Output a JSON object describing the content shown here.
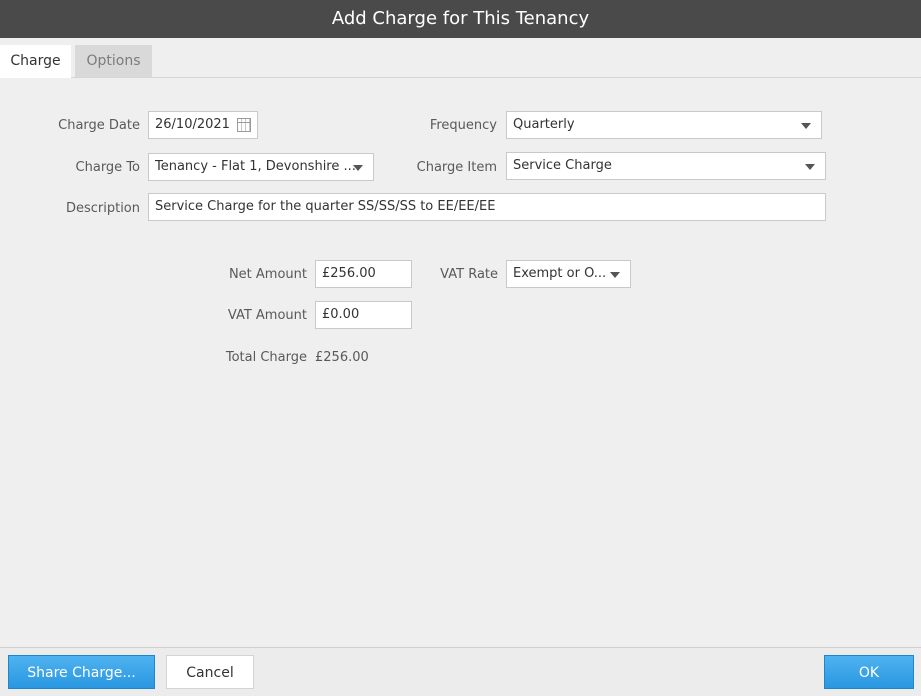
{
  "window": {
    "title": "Add Charge for This Tenancy"
  },
  "tabs": [
    {
      "label": "Charge",
      "active": true
    },
    {
      "label": "Options",
      "active": false
    }
  ],
  "form": {
    "charge_date": {
      "label": "Charge Date",
      "value": "26/10/2021",
      "icon": "calendar-icon"
    },
    "frequency": {
      "label": "Frequency",
      "value": "Quarterly"
    },
    "charge_to": {
      "label": "Charge To",
      "value": "Tenancy - Flat 1, Devonshire ..."
    },
    "charge_item": {
      "label": "Charge Item",
      "value": "Service Charge"
    },
    "description": {
      "label": "Description",
      "value": "Service Charge for the quarter SS/SS/SS to EE/EE/EE"
    },
    "net_amount": {
      "label": "Net Amount",
      "value": "£256.00"
    },
    "vat_rate": {
      "label": "VAT Rate",
      "value": "Exempt or O..."
    },
    "vat_amount": {
      "label": "VAT Amount",
      "value": "£0.00"
    },
    "total_charge": {
      "label": "Total Charge",
      "value": "£256.00"
    }
  },
  "footer": {
    "share_label": "Share Charge...",
    "cancel_label": "Cancel",
    "ok_label": "OK"
  },
  "colors": {
    "titlebar": "#4a4a4a",
    "accent": "#2997e0",
    "background": "#efefef"
  }
}
